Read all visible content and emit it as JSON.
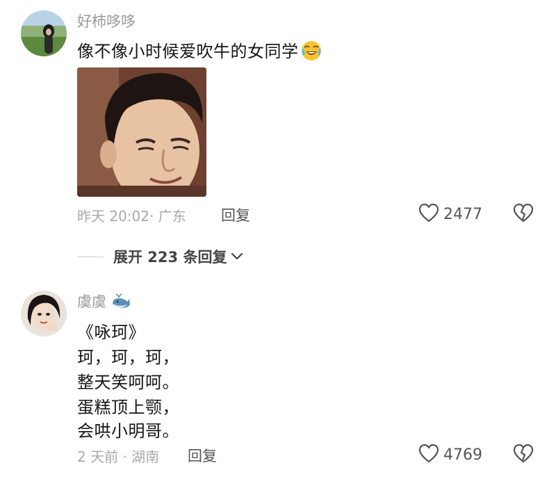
{
  "comments": [
    {
      "username": "好柿哆哆",
      "text": "像不像小时候爱吹牛的女同学",
      "emoji_icon": "crying-laughing-face",
      "has_image": true,
      "meta": "昨天 20:02· 广东",
      "reply_label": "回复",
      "likes": "2477"
    },
    {
      "username": "虞虞",
      "badge_icon": "whale",
      "lines": [
        "《咏珂》",
        "珂，珂，珂，",
        "整天笑呵呵。",
        "蛋糕顶上颚，",
        "会哄小明哥。"
      ],
      "meta": "2 天前 · 湖南",
      "reply_label": "回复",
      "likes": "4769"
    }
  ],
  "expand_replies": {
    "label": "展开 223 条回复"
  },
  "colors": {
    "meta_gray": "#a8a8a8",
    "username_gray": "#9a9a9a",
    "text": "#161616"
  }
}
